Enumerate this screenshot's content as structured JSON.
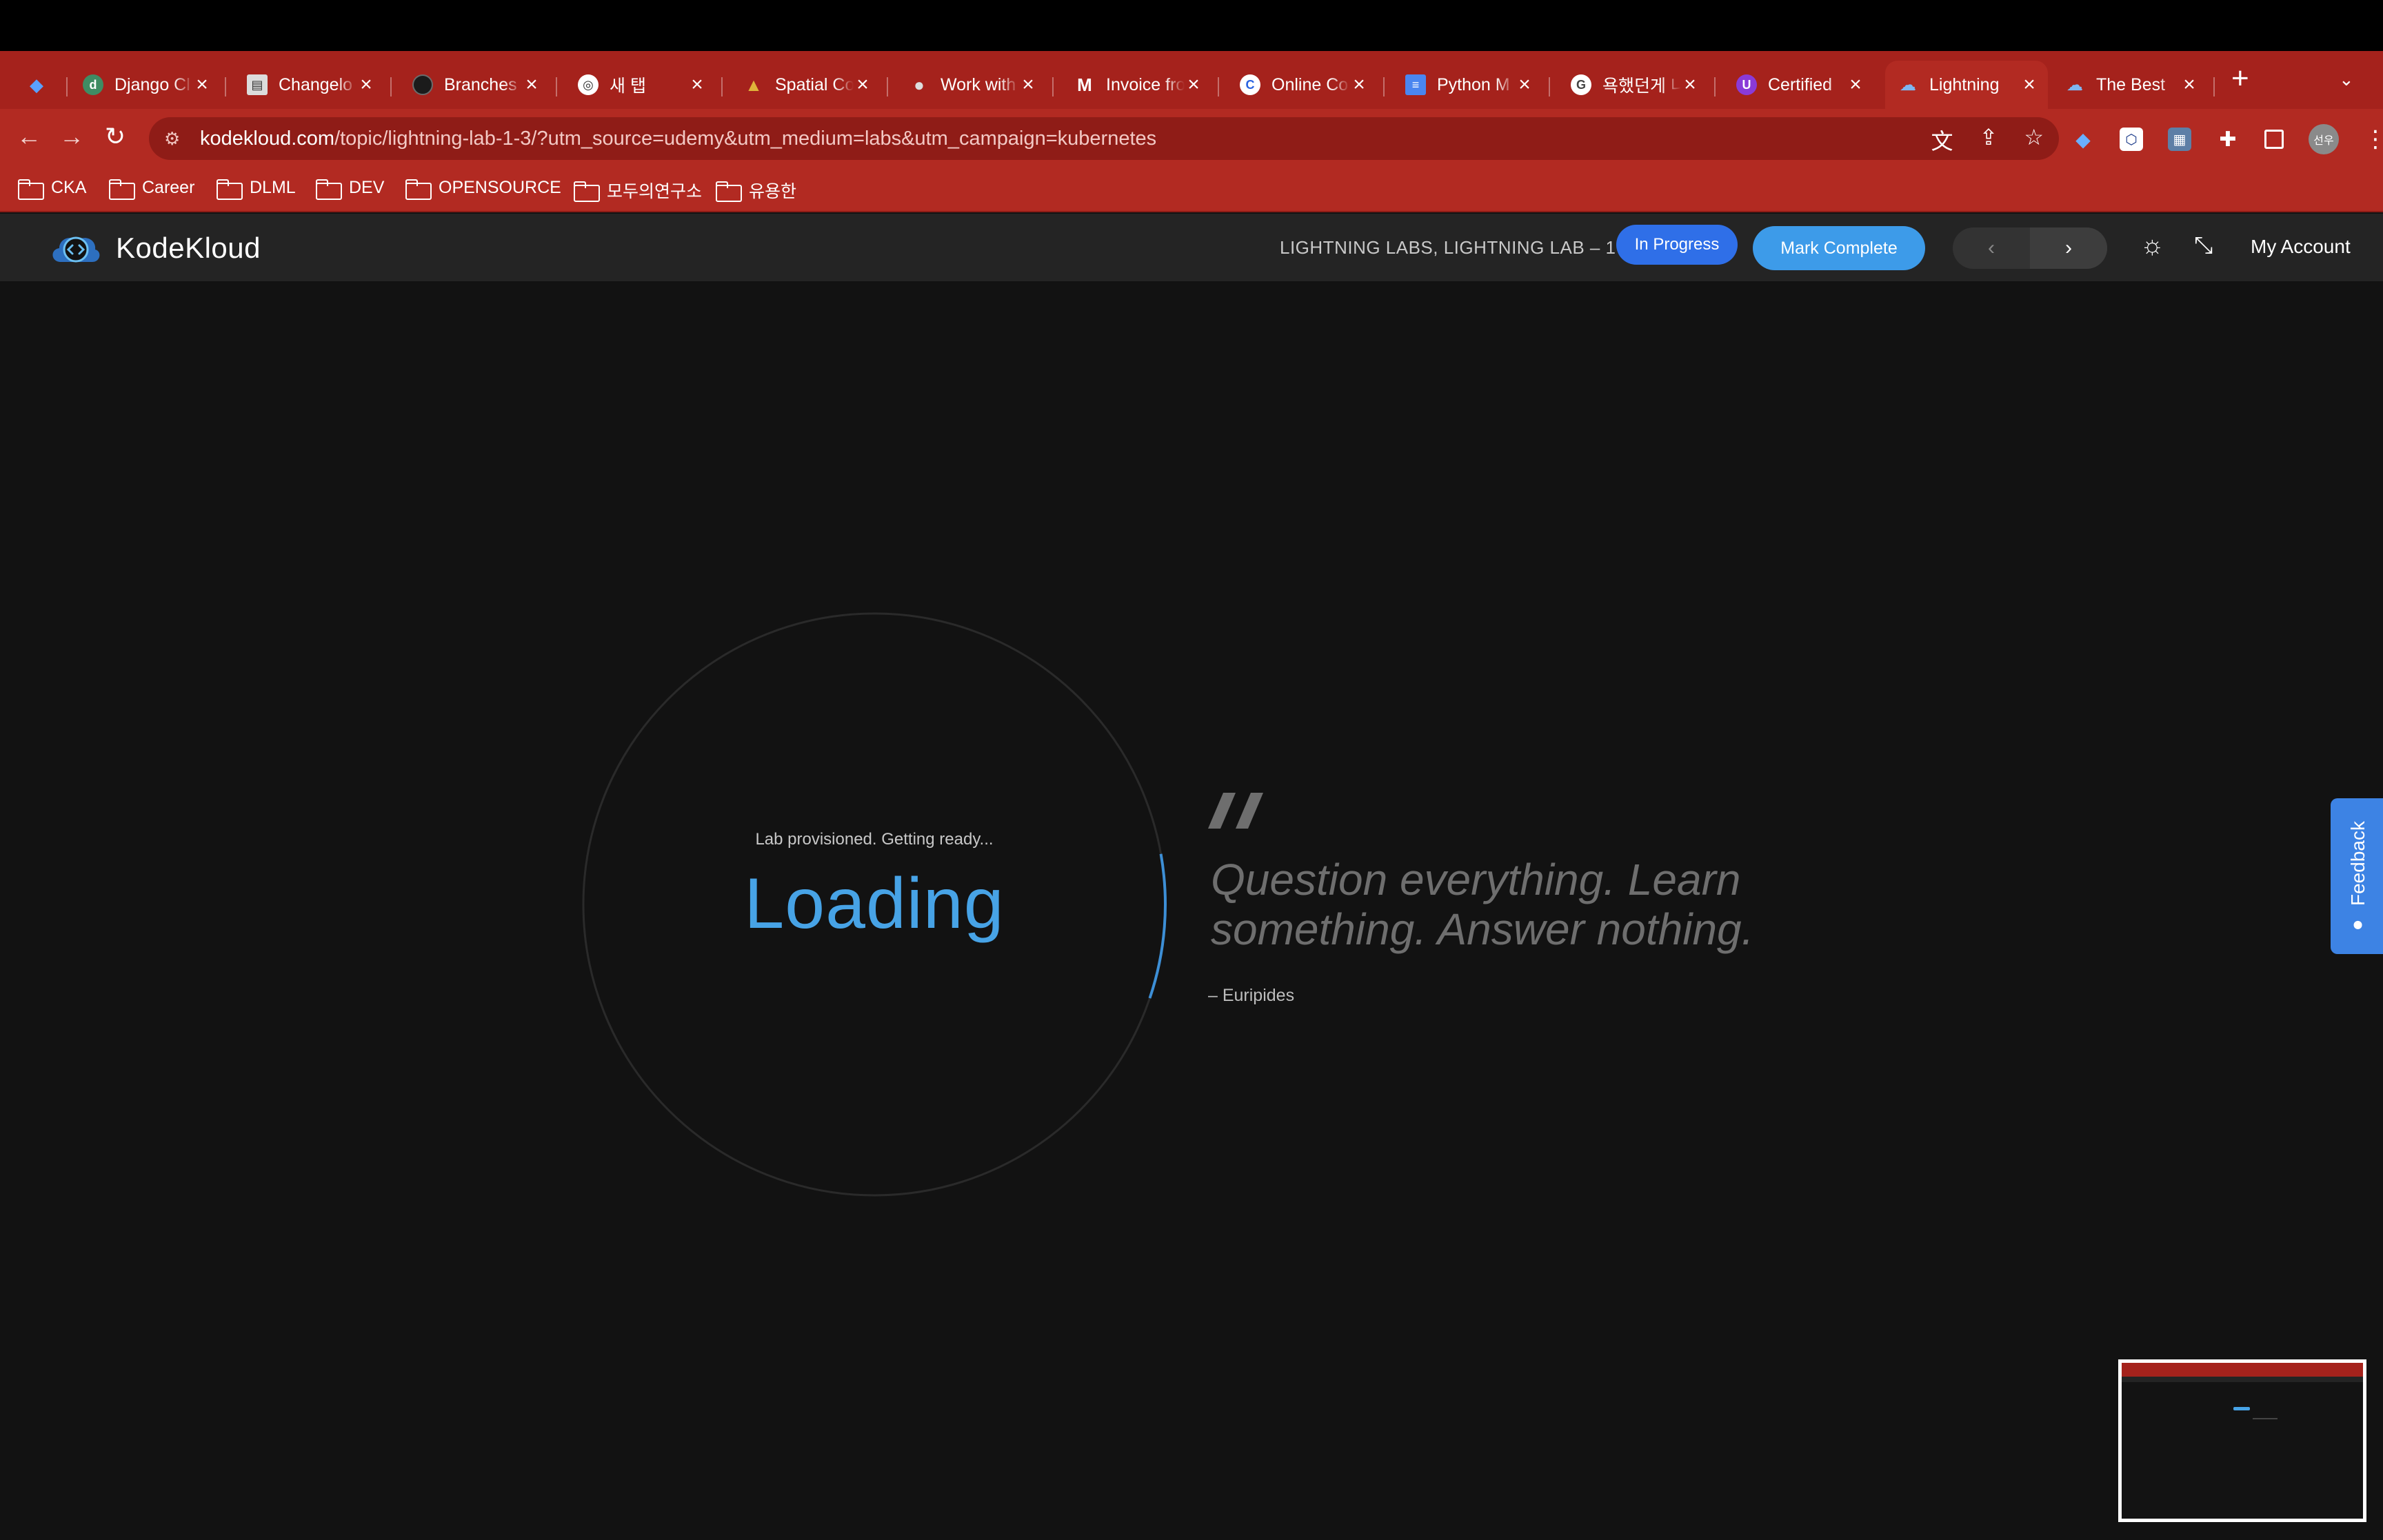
{
  "browser": {
    "tabs": [
      {
        "title": "",
        "icon": "gem-icon",
        "color": "#3d7be0"
      },
      {
        "title": "Django Cl",
        "icon": "django-icon",
        "color": "#4a9a6c"
      },
      {
        "title": "Changelo",
        "icon": "table-icon",
        "color": "#d8d8d8"
      },
      {
        "title": "Branches",
        "icon": "github-icon",
        "color": "#222222"
      },
      {
        "title": "새 탭",
        "icon": "chrome-icon",
        "color": "#ffffff"
      },
      {
        "title": "Spatial Co",
        "icon": "tent-icon",
        "color": "#c79a2c"
      },
      {
        "title": "Work with",
        "icon": "apple-icon",
        "color": "#dddddd"
      },
      {
        "title": "Invoice fro",
        "icon": "gmail-icon",
        "color": "#ea4335"
      },
      {
        "title": "Online Co",
        "icon": "coursera-icon",
        "color": "#2a63e0"
      },
      {
        "title": "Python M",
        "icon": "docs-icon",
        "color": "#4a86f0"
      },
      {
        "title": "욕했던게 나",
        "icon": "google-icon",
        "color": "#ffffff"
      },
      {
        "title": "Certified",
        "icon": "udemy-icon",
        "color": "#8a3ad8"
      },
      {
        "title": "Lightning",
        "icon": "kodekloud-icon",
        "color": "#6aa7e8"
      },
      {
        "title": "The Best",
        "icon": "kodekloud-icon",
        "color": "#6aa7e8"
      }
    ],
    "url_host": "kodekloud.com",
    "url_path": "/topic/lightning-lab-1-3/?utm_source=udemy&utm_medium=labs&utm_campaign=kubernetes",
    "avatar_text": "선우",
    "bookmarks": [
      "CKA",
      "Career",
      "DLML",
      "DEV",
      "OPENSOURCE",
      "모두의연구소",
      "유용한"
    ]
  },
  "header": {
    "logo_text": "KodeKloud",
    "breadcrumb": "LIGHTNING LABS, LIGHTNING LAB – 1",
    "status_label": "In Progress",
    "mark_complete_label": "Mark Complete",
    "prev_symbol": "‹",
    "next_symbol": "›",
    "account_label": "My Account"
  },
  "main": {
    "loader_status": "Lab provisioned. Getting ready...",
    "loader_text": "Loading",
    "loader_progress": 0.08,
    "quote_text": "Question everything. Learn something. Answer nothing.",
    "quote_author": "– Euripides"
  },
  "feedback": {
    "label": "Feedback"
  },
  "colors": {
    "accent": "#47a3e6",
    "progress_btn": "#2f6fe8",
    "complete_btn": "#3d9be9",
    "browser": "#b22a22"
  }
}
